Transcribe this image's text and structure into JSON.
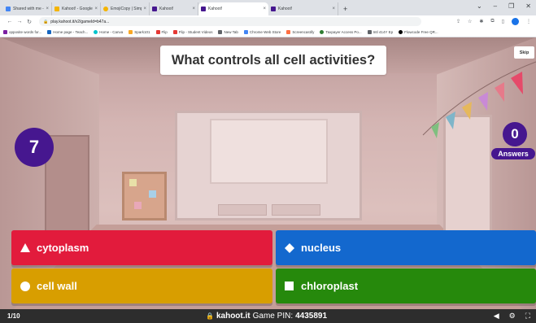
{
  "browser": {
    "tabs": [
      {
        "title": "Shared with me - Google Dr",
        "color": "#4285f4",
        "active": false
      },
      {
        "title": "Kahoot! - Google Slides",
        "color": "#f4b400",
        "active": false
      },
      {
        "title": "EmojiCopy | Simple emoji",
        "color": "#f4b400",
        "active": false
      },
      {
        "title": "Kahoot!",
        "color": "#46178f",
        "active": false
      },
      {
        "title": "Kahoot!",
        "color": "#46178f",
        "active": true
      },
      {
        "title": "Kahoot!",
        "color": "#46178f",
        "active": false
      }
    ],
    "url": "play.kahoot.it/v2/gameId=b47a...",
    "bookmarks": [
      {
        "label": "opposite words for...",
        "color": "#7b1fa2"
      },
      {
        "label": "Home page - Teach...",
        "color": "#1565c0"
      },
      {
        "label": "Home - Canva",
        "color": "#00c4cc"
      },
      {
        "label": "Spark101",
        "color": "#f9a825"
      },
      {
        "label": "Flip",
        "color": "#e53935"
      },
      {
        "label": "Flip - Student Videos",
        "color": "#e53935"
      },
      {
        "label": "New Tab",
        "color": "#5f6368"
      },
      {
        "label": "Chrome Web Store",
        "color": "#4285f4"
      },
      {
        "label": "Screencastify",
        "color": "#ff7043"
      },
      {
        "label": "Taxpayer Access Po...",
        "color": "#2e7d32"
      },
      {
        "label": "Intl 414Y Ep",
        "color": "#5f6368"
      },
      {
        "label": "Flowcode Free QR...",
        "color": "#000000"
      }
    ]
  },
  "question": {
    "text": "What controls all cell activities?",
    "skip_label": "Skip"
  },
  "timer": {
    "value": "7"
  },
  "answers_count": {
    "value": "0",
    "label": "Answers"
  },
  "options": [
    {
      "label": "cytoplasm",
      "shape": "triangle-icon",
      "color": "#e21b3c"
    },
    {
      "label": "nucleus",
      "shape": "diamond-icon",
      "color": "#1368ce"
    },
    {
      "label": "cell wall",
      "shape": "circle-icon",
      "color": "#d89e00"
    },
    {
      "label": "chloroplast",
      "shape": "square-icon",
      "color": "#26890c"
    }
  ],
  "footer": {
    "counter": "1/10",
    "site": "kahoot.it",
    "pin_label": "Game PIN:",
    "pin": "4435891"
  }
}
